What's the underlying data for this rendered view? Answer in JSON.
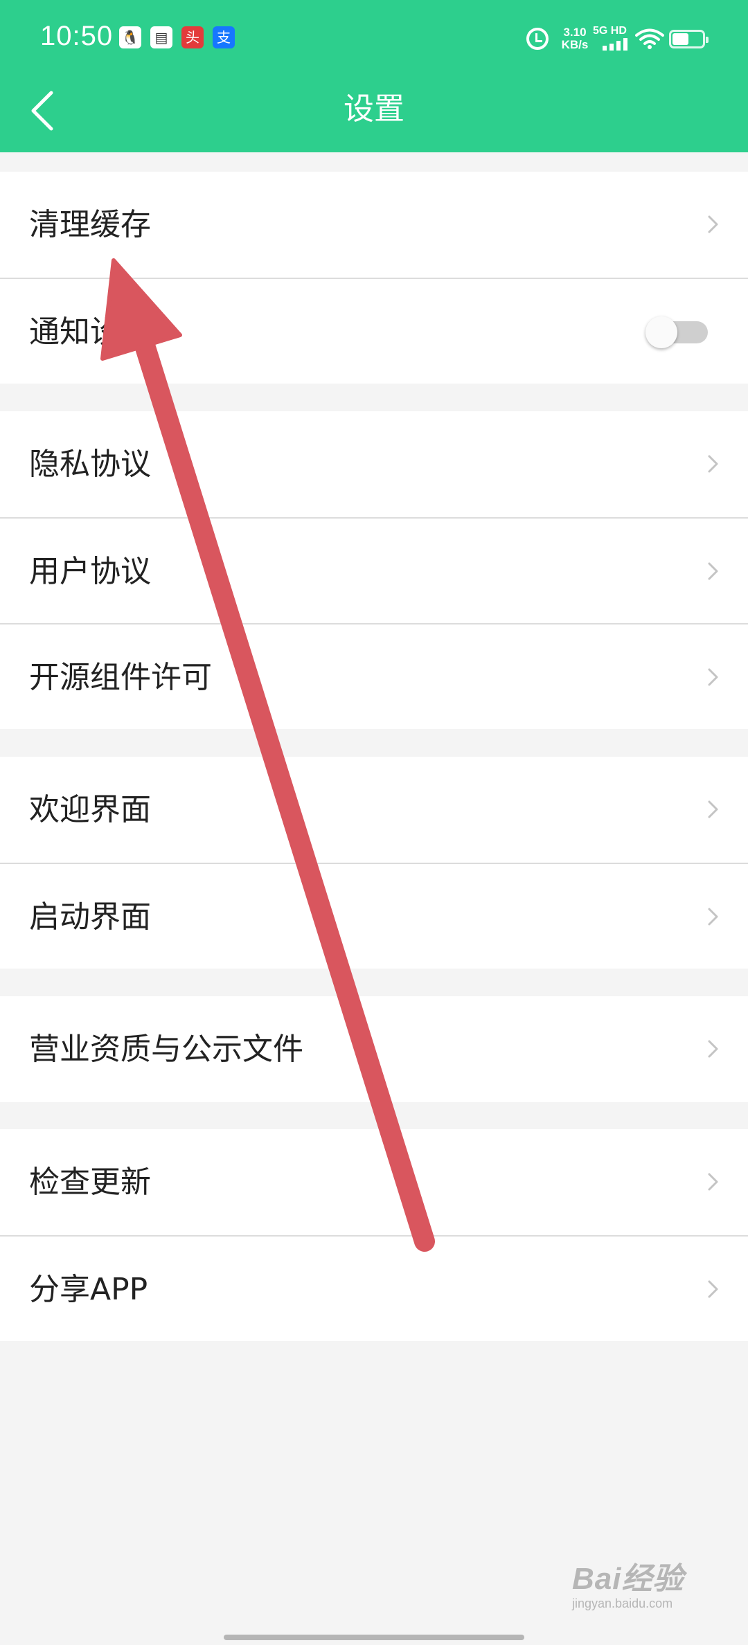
{
  "status_bar": {
    "time": "10:50",
    "net_speed_value": "3.10",
    "net_speed_unit": "KB/s",
    "signal_label": "5G HD",
    "battery_level": 0.55
  },
  "header": {
    "title": "设置"
  },
  "groups": [
    {
      "rows": [
        {
          "label": "清理缓存"
        },
        {
          "label": "通知设置",
          "toggle_on": false
        }
      ]
    },
    {
      "rows": [
        {
          "label": "隐私协议"
        },
        {
          "label": "用户协议"
        },
        {
          "label": "开源组件许可"
        }
      ]
    },
    {
      "rows": [
        {
          "label": "欢迎界面"
        },
        {
          "label": "启动界面"
        }
      ]
    },
    {
      "rows": [
        {
          "label": "营业资质与公示文件"
        }
      ]
    },
    {
      "rows": [
        {
          "label": "检查更新"
        },
        {
          "label": "分享APP"
        }
      ]
    }
  ],
  "watermark": {
    "logo_text": "Bai经验",
    "url": "jingyan.baidu.com"
  },
  "colors": {
    "brand": "#2dcf8d",
    "annotation": "#d9565e"
  }
}
